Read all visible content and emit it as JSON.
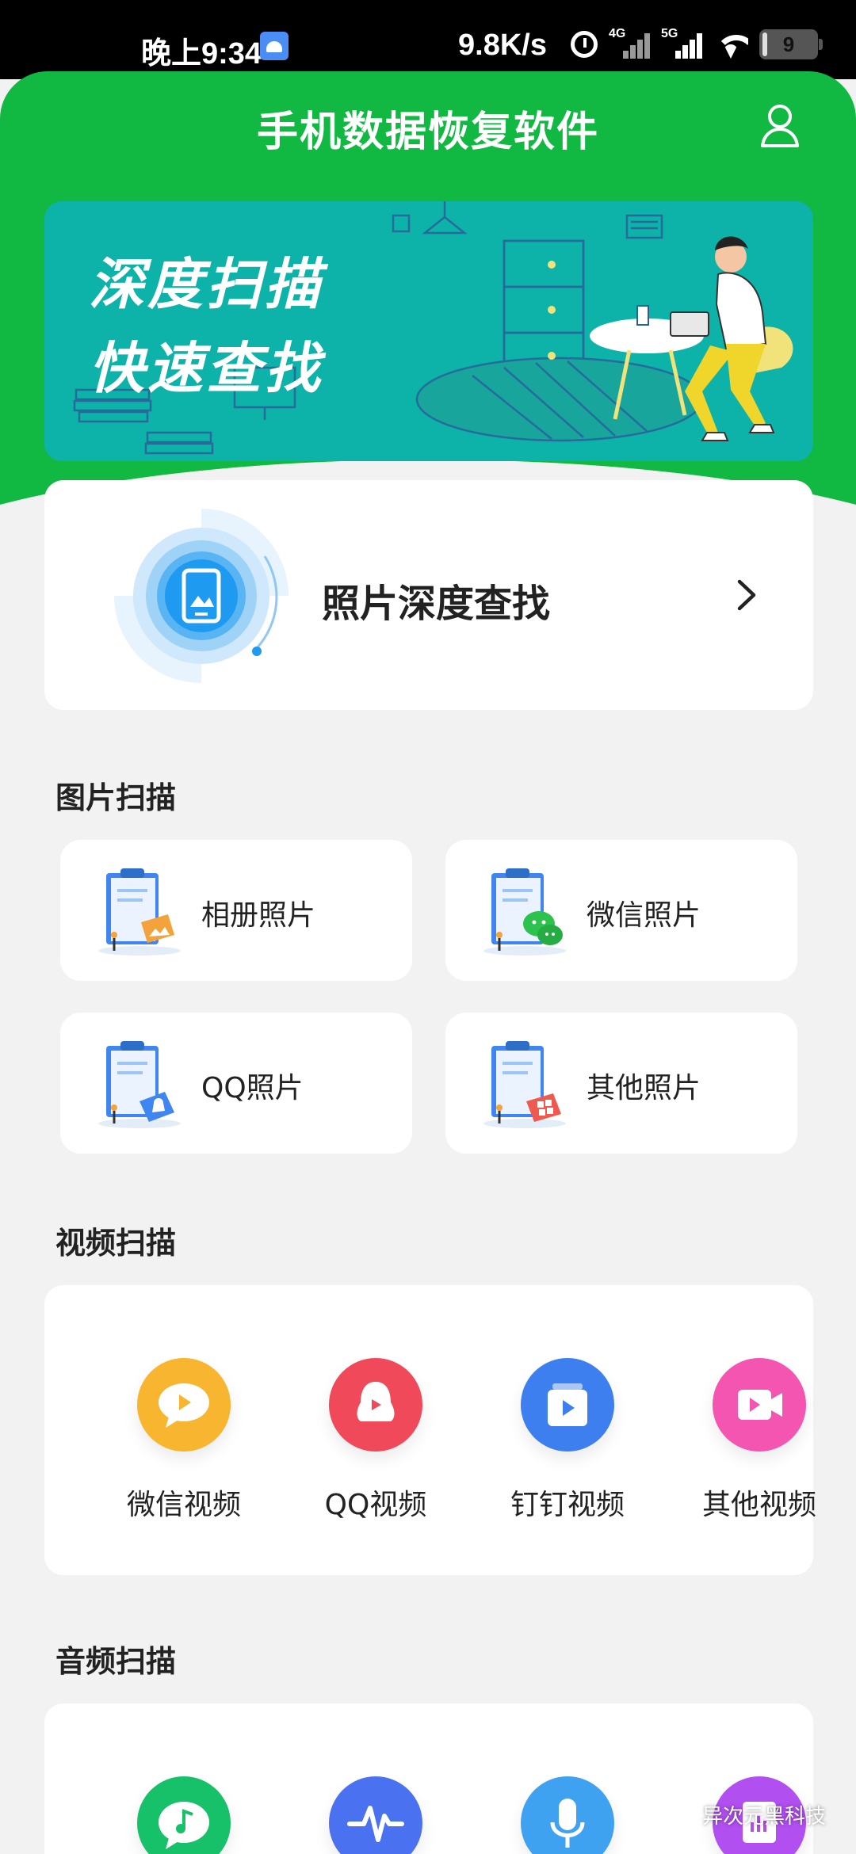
{
  "status_bar": {
    "time": "晚上9:34",
    "net_speed": "9.8K/s",
    "signal1_label": "4G",
    "signal2_label": "5G",
    "battery_level": "9",
    "battery_fraction": 0.09
  },
  "header": {
    "title": "手机数据恢复软件"
  },
  "banner": {
    "line1": "深度扫描",
    "line2": "快速查找"
  },
  "photo_deep": {
    "label": "照片深度查找"
  },
  "image_scan": {
    "title": "图片扫描",
    "items": [
      {
        "label": "相册照片",
        "accent": "#f4a23a"
      },
      {
        "label": "微信照片",
        "accent": "#2cc24d"
      },
      {
        "label": "QQ照片",
        "accent": "#3f86f0"
      },
      {
        "label": "其他照片",
        "accent": "#f05a4e"
      }
    ]
  },
  "video_scan": {
    "title": "视频扫描",
    "items": [
      {
        "label": "微信视频",
        "color": "#f8b530"
      },
      {
        "label": "QQ视频",
        "color": "#f04a5a"
      },
      {
        "label": "钉钉视频",
        "color": "#3e7ff0"
      },
      {
        "label": "其他视频",
        "color": "#f455b0"
      }
    ]
  },
  "audio_scan": {
    "title": "音频扫描",
    "items": [
      {
        "color": "#17c16a"
      },
      {
        "color": "#4a72f0"
      },
      {
        "color": "#3fa2f0"
      },
      {
        "color": "#b14ff0"
      }
    ]
  },
  "watermark": {
    "text": "异次元黑科技"
  },
  "colors": {
    "brand_green": "#11b842",
    "banner_teal": "#0db2a8",
    "page_bg": "#f2f2f2"
  }
}
